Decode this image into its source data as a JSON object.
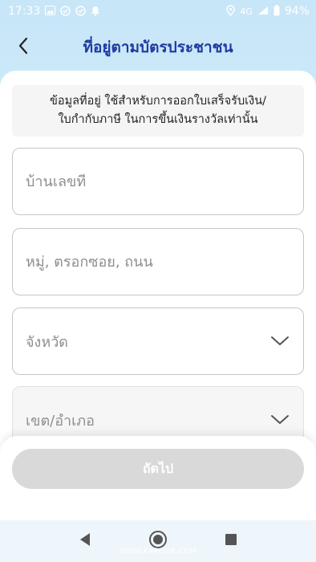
{
  "status_bar": {
    "time": "17:33",
    "network": "4G",
    "battery": "94%",
    "left_icons": [
      "image-icon",
      "check-circle-icon",
      "check-circle-icon",
      "bell-icon"
    ],
    "right_icons": [
      "location-icon",
      "signal-icon",
      "battery-icon"
    ]
  },
  "header": {
    "title": "ที่อยู่ตามบัตรประชาชน",
    "back_icon": "chevron-left-icon"
  },
  "notice": {
    "line1": "ข้อมูลที่อยู่ ใช้สำหรับการออกใบเสร็จรับเงิน/",
    "line2": "ใบกำกับภาษี ในการขึ้นเงินรางวัลเท่านั้น"
  },
  "form": {
    "house_no": {
      "placeholder": "บ้านเลขที่",
      "value": ""
    },
    "street": {
      "placeholder": "หมู่, ตรอกซอย, ถนน",
      "value": ""
    },
    "province": {
      "label": "จังหวัด",
      "icon": "chevron-down-icon"
    },
    "district": {
      "label": "เขต/อำเภอ",
      "icon": "chevron-down-icon"
    }
  },
  "actions": {
    "next_label": "ถัดไป"
  },
  "nav": {
    "icons": [
      "back-triangle-icon",
      "home-circle-icon",
      "recents-square-icon"
    ]
  },
  "watermark": "WWW.KAPOOK.COM",
  "colors": {
    "title": "#1f3aa0",
    "background_top": "#c7e6f8",
    "button_disabled": "#d9d9d9",
    "field_border": "#c6c6c6"
  }
}
